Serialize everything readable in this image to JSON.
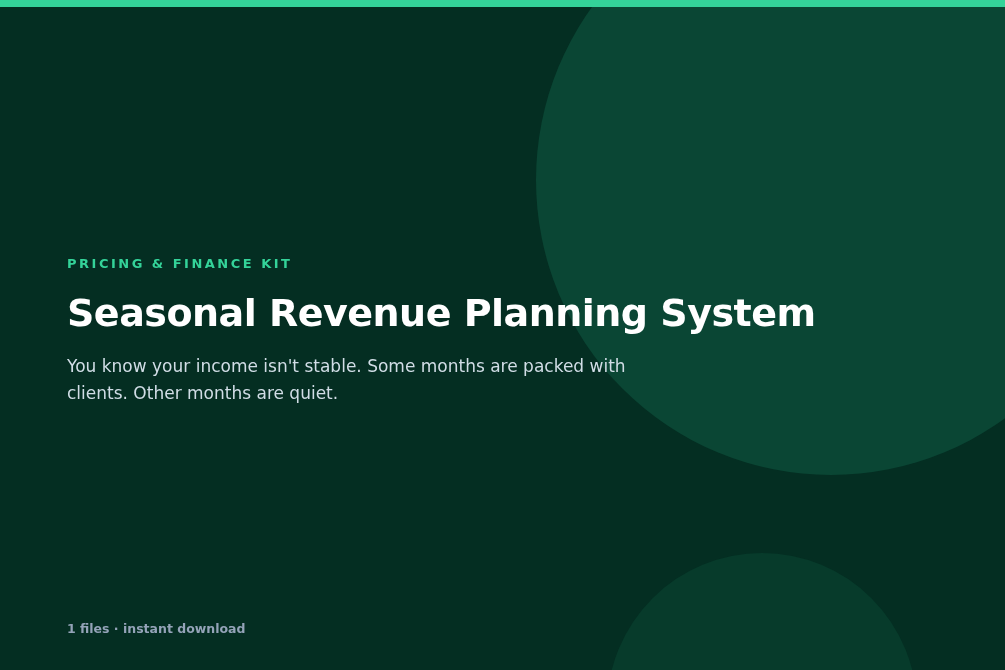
{
  "eyebrow": "PRICING & FINANCE KIT",
  "title": "Seasonal Revenue Planning System",
  "description": "You know your income isn't stable. Some months are packed with clients. Other months are quiet.",
  "footer": "1 files · instant download"
}
